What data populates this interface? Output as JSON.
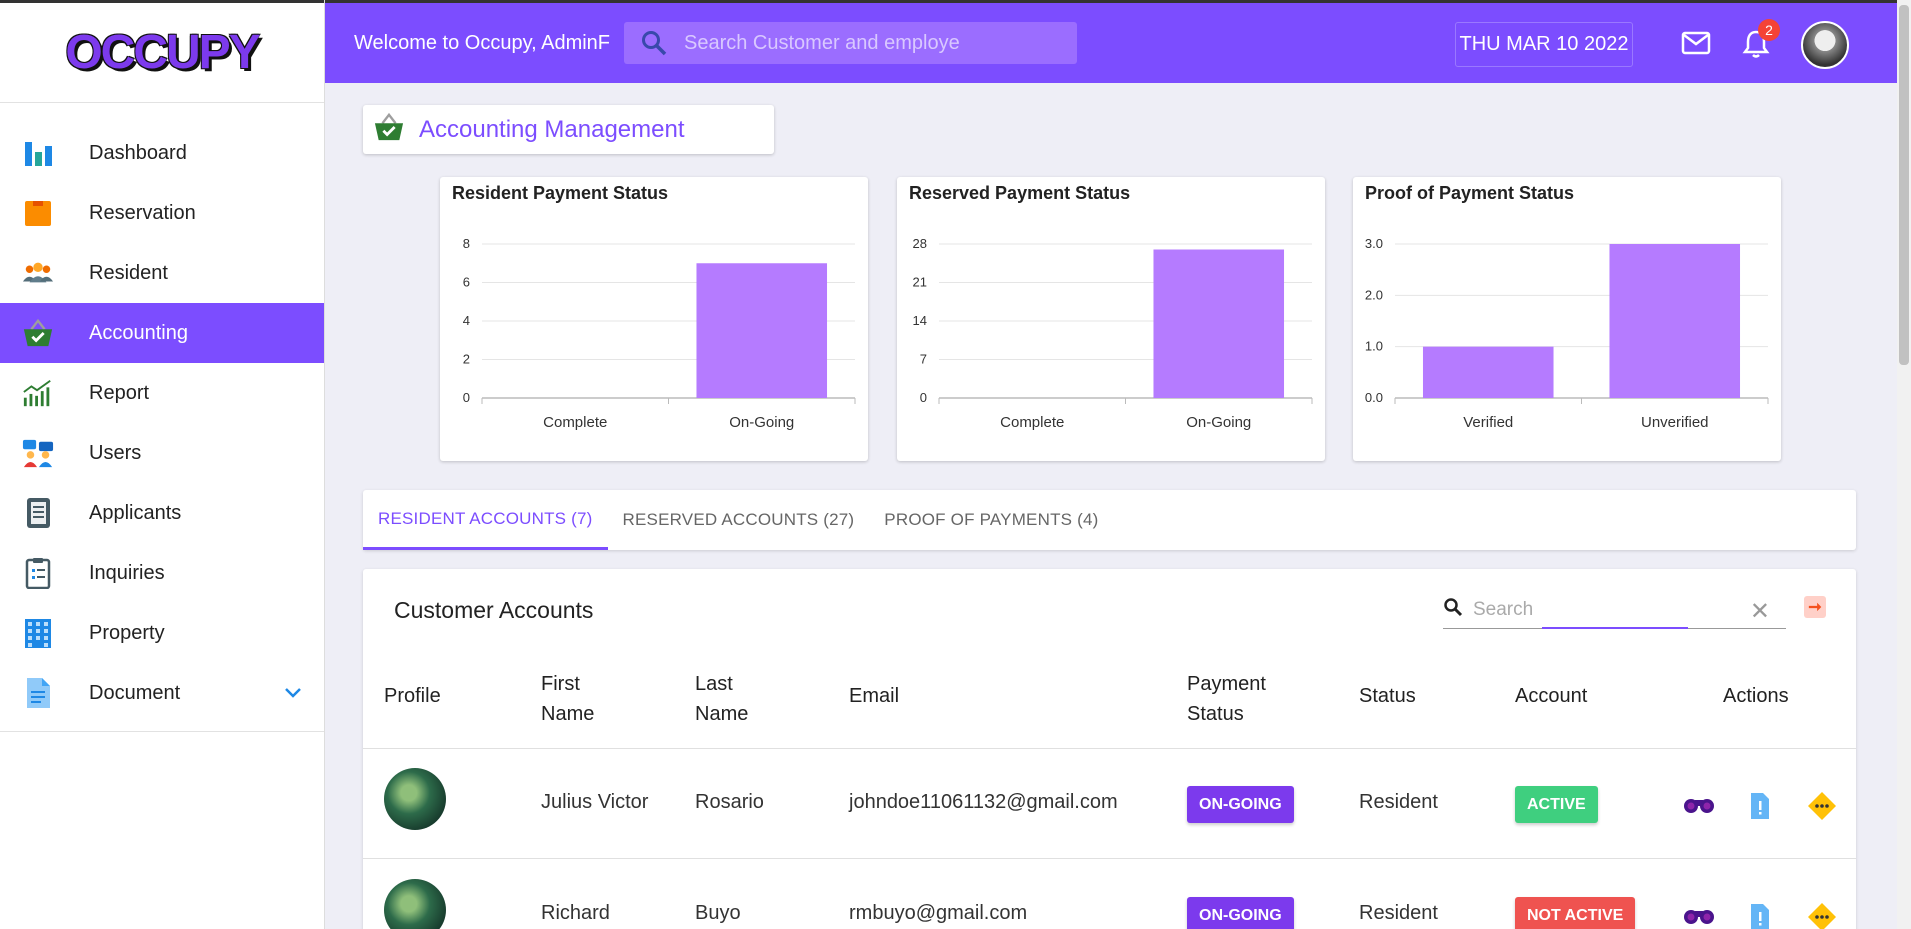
{
  "brand": {
    "logo_text": "OCCUPY"
  },
  "sidebar": {
    "items": [
      {
        "label": "Dashboard",
        "icon": "bar-chart-icon"
      },
      {
        "label": "Reservation",
        "icon": "box-icon"
      },
      {
        "label": "Resident",
        "icon": "people-icon"
      },
      {
        "label": "Accounting",
        "icon": "basket-icon",
        "active": true
      },
      {
        "label": "Report",
        "icon": "trend-chart-icon"
      },
      {
        "label": "Users",
        "icon": "users-chat-icon"
      },
      {
        "label": "Applicants",
        "icon": "book-icon"
      },
      {
        "label": "Inquiries",
        "icon": "clipboard-icon"
      },
      {
        "label": "Property",
        "icon": "building-icon"
      },
      {
        "label": "Document",
        "icon": "document-icon",
        "expandable": true
      }
    ]
  },
  "header": {
    "welcome": "Welcome to Occupy, AdminF",
    "search_placeholder": "Search Customer and employe",
    "date": "THU MAR 10 2022",
    "notification_count": "2"
  },
  "page": {
    "title": "Accounting Management"
  },
  "chart_data": [
    {
      "type": "bar",
      "title": "Resident Payment Status",
      "categories": [
        "Complete",
        "On-Going"
      ],
      "values": [
        0,
        7
      ],
      "yticks": [
        "0",
        "2",
        "4",
        "6",
        "8"
      ],
      "ylim": [
        0,
        8
      ],
      "color": "#b57bff"
    },
    {
      "type": "bar",
      "title": "Reserved Payment Status",
      "categories": [
        "Complete",
        "On-Going"
      ],
      "values": [
        0,
        27
      ],
      "yticks": [
        "0",
        "7",
        "14",
        "21",
        "28"
      ],
      "ylim": [
        0,
        28
      ],
      "color": "#b57bff"
    },
    {
      "type": "bar",
      "title": "Proof of Payment Status",
      "categories": [
        "Verified",
        "Unverified"
      ],
      "values": [
        1,
        3
      ],
      "yticks": [
        "0.0",
        "1.0",
        "2.0",
        "3.0"
      ],
      "ylim": [
        0,
        3
      ],
      "color": "#b57bff"
    }
  ],
  "tabs": [
    {
      "label": "RESIDENT ACCOUNTS (7)",
      "active": true
    },
    {
      "label": "RESERVED ACCOUNTS (27)"
    },
    {
      "label": "PROOF OF PAYMENTS (4)"
    }
  ],
  "table": {
    "title": "Customer Accounts",
    "search_placeholder": "Search",
    "columns": {
      "profile": "Profile",
      "first_name_1": "First",
      "first_name_2": "Name",
      "last_name_1": "Last",
      "last_name_2": "Name",
      "email": "Email",
      "payment_1": "Payment",
      "payment_2": "Status",
      "status": "Status",
      "account": "Account",
      "actions": "Actions"
    },
    "rows": [
      {
        "first_name": "Julius Victor",
        "last_name": "Rosario",
        "email": "johndoe11061132@gmail.com",
        "payment_status": "ON-GOING",
        "status": "Resident",
        "account": "ACTIVE"
      },
      {
        "first_name": "Richard",
        "last_name": "Buyo",
        "email": "rmbuyo@gmail.com",
        "payment_status": "ON-GOING",
        "status": "Resident",
        "account": "NOT ACTIVE"
      }
    ]
  },
  "colors": {
    "primary": "#7c4dff",
    "bar": "#b57bff",
    "active": "#3fcf7f",
    "inactive": "#ef5350",
    "badge": "#f44336"
  }
}
